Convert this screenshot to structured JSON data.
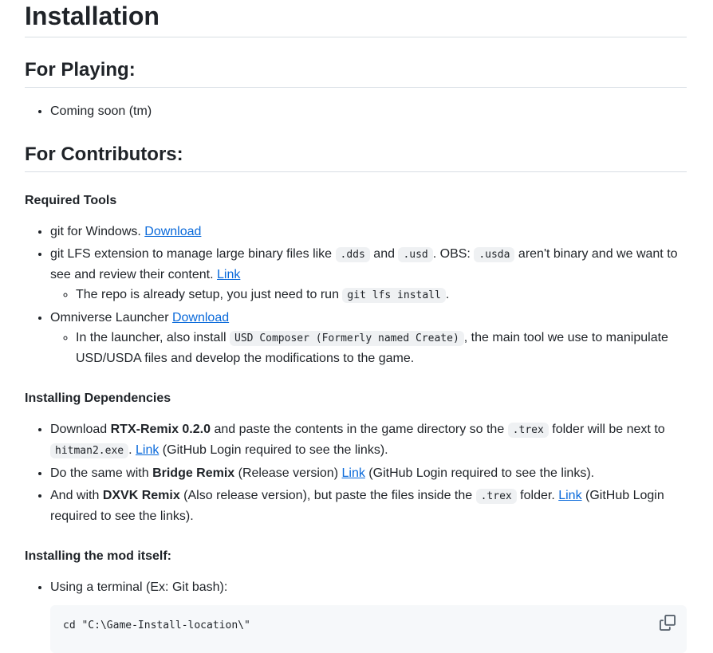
{
  "title": "Installation",
  "playing": {
    "heading": "For Playing:",
    "items": [
      "Coming soon (tm)"
    ]
  },
  "contributors": {
    "heading": "For Contributors:",
    "tools": {
      "heading": "Required Tools",
      "item1": {
        "text": "git for Windows. ",
        "link": "Download"
      },
      "item2": {
        "text_a": "git LFS extension to manage large binary files like ",
        "code_a": ".dds",
        "text_b": " and ",
        "code_b": ".usd",
        "text_c": ". OBS: ",
        "code_c": ".usda",
        "text_d": " aren't binary and we want to see and review their content. ",
        "link": "Link",
        "sub_text_a": "The repo is already setup, you just need to run ",
        "sub_code": "git lfs install",
        "sub_text_b": "."
      },
      "item3": {
        "text": "Omniverse Launcher ",
        "link": "Download",
        "sub_text_a": "In the launcher, also install ",
        "sub_code": "USD Composer (Formerly named Create)",
        "sub_text_b": ", the main tool we use to manipulate USD/USDA files and develop the modifications to the game."
      }
    },
    "deps": {
      "heading": "Installing Dependencies",
      "item1": {
        "text_a": "Download ",
        "bold": "RTX-Remix 0.2.0",
        "text_b": " and paste the contents in the game directory so the ",
        "code_a": ".trex",
        "text_c": " folder will be next to ",
        "code_b": "hitman2.exe",
        "text_d": ". ",
        "link": "Link",
        "text_e": " (GitHub Login required to see the links)."
      },
      "item2": {
        "text_a": "Do the same with ",
        "bold": "Bridge Remix",
        "text_b": " (Release version) ",
        "link": "Link",
        "text_c": " (GitHub Login required to see the links)."
      },
      "item3": {
        "text_a": "And with ",
        "bold": "DXVK Remix",
        "text_b": " (Also release version), but paste the files inside the ",
        "code": ".trex",
        "text_c": " folder. ",
        "link": "Link",
        "text_d": " (GitHub Login required to see the links)."
      }
    },
    "mod": {
      "heading": "Installing the mod itself:",
      "item1": "Using a terminal (Ex: Git bash):",
      "code_line": "cd \"C:\\Game-Install-location\\\"",
      "copy_icon": "copy-icon"
    }
  },
  "colors": {
    "link": "#0969da",
    "text": "#1f2328",
    "code_bg": "#eff1f3",
    "codeblock_bg": "#f6f8fa",
    "divider": "#d8dee4"
  }
}
